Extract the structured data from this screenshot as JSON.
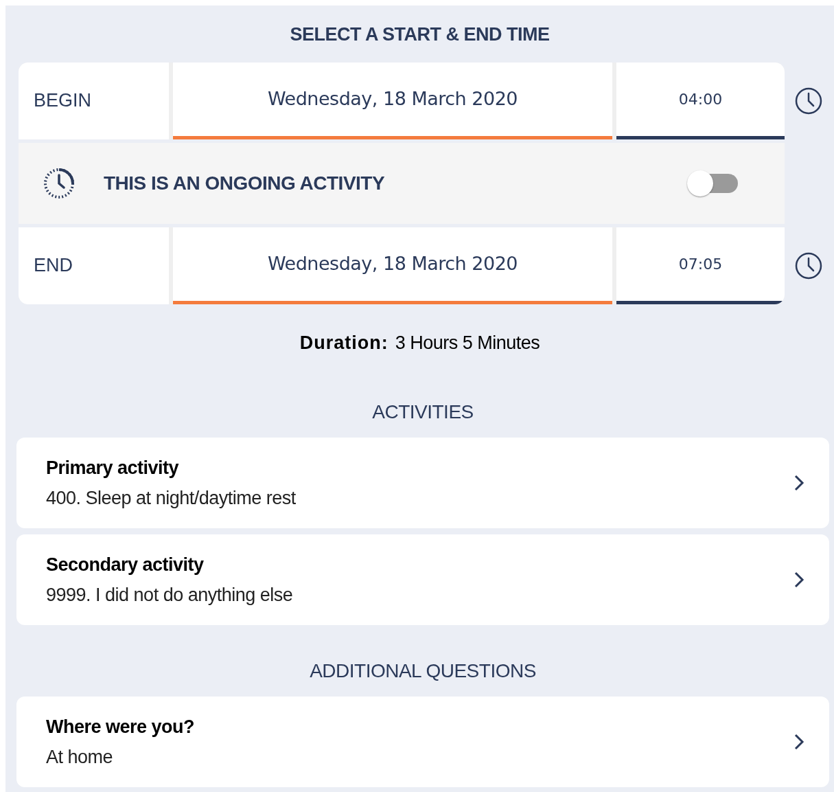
{
  "title": "SELECT A START & END TIME",
  "begin": {
    "label": "BEGIN",
    "date": "Wednesday, 18 March 2020",
    "time": "04:00"
  },
  "ongoing": {
    "label": "THIS IS AN ONGOING ACTIVITY",
    "on": false
  },
  "end": {
    "label": "END",
    "date": "Wednesday, 18 March 2020",
    "time": "07:05"
  },
  "duration": {
    "label": "Duration:",
    "value": "3 Hours 5 Minutes"
  },
  "sections": [
    {
      "heading": "ACTIVITIES",
      "items": [
        {
          "title": "Primary activity",
          "value": "400. Sleep at night/daytime rest"
        },
        {
          "title": "Secondary activity",
          "value": "9999. I did not do anything else"
        }
      ]
    },
    {
      "heading": "ADDITIONAL QUESTIONS",
      "items": [
        {
          "title": "Where were you?",
          "value": "At home"
        }
      ]
    }
  ]
}
